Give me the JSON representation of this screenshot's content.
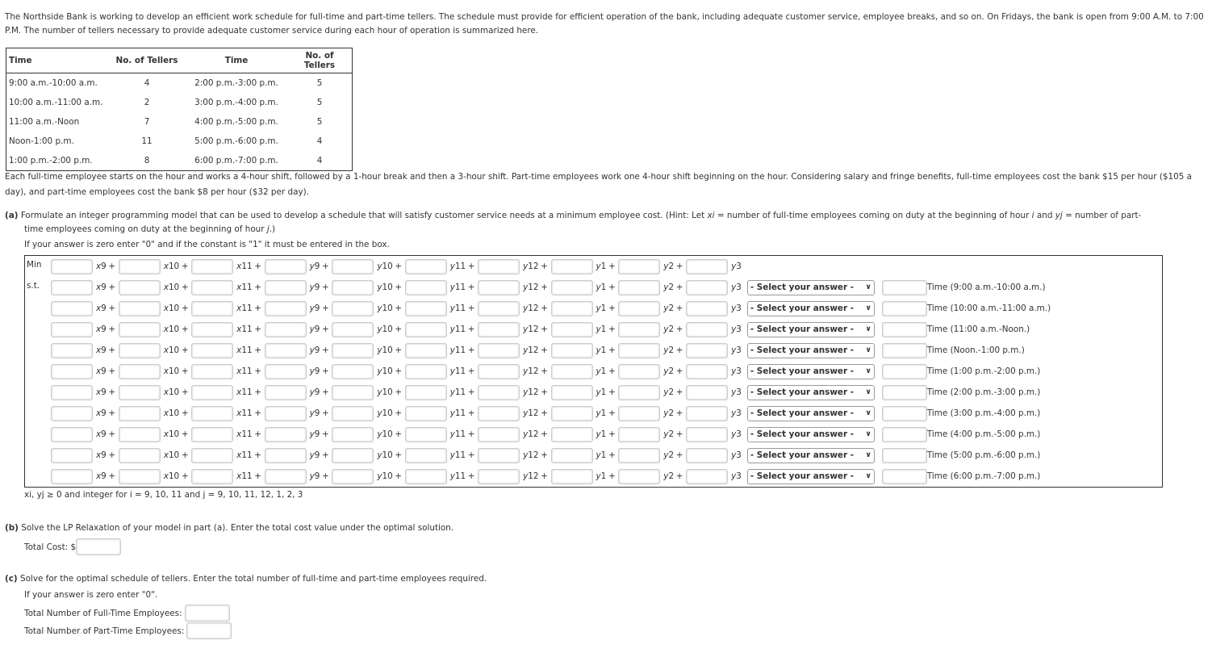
{
  "intro": "The Northside Bank is working to develop an efficient work schedule for full-time and part-time tellers. The schedule must provide for efficient operation of the bank, including adequate customer service, employee breaks, and so on. On Fridays, the bank is open from 9:00 A.M. to 7:00 P.M. The number of tellers necessary to provide adequate customer service during each hour of operation is summarized here.",
  "tellers_table": {
    "headers": [
      "Time",
      "No. of Tellers",
      "Time",
      "No. of Tellers"
    ],
    "rows": [
      [
        "9:00 a.m.-10:00 a.m.",
        "4",
        "2:00 p.m.-3:00 p.m.",
        "5"
      ],
      [
        "10:00 a.m.-11:00 a.m.",
        "2",
        "3:00 p.m.-4:00 p.m.",
        "5"
      ],
      [
        "11:00 a.m.-Noon",
        "7",
        "4:00 p.m.-5:00 p.m.",
        "5"
      ],
      [
        "Noon-1:00 p.m.",
        "11",
        "5:00 p.m.-6:00 p.m.",
        "4"
      ],
      [
        "1:00 p.m.-2:00 p.m.",
        "8",
        "6:00 p.m.-7:00 p.m.",
        "4"
      ]
    ]
  },
  "shift_text": "Each full-time employee starts on the hour and works a 4-hour shift, followed by a 1-hour break and then a 3-hour shift. Part-time employees work one 4-hour shift beginning on the hour. Considering salary and fringe benefits, full-time employees cost the bank $15 per hour ($105 a day), and part-time employees cost the bank $8 per hour ($32 per day).",
  "part_a": {
    "label": "(a)",
    "text1": " Formulate an integer programming model that can be used to develop a schedule that will satisfy customer service needs at a minimum employee cost. (Hint: Let ",
    "xi": "xi",
    "text2": " = number of full-time employees coming on duty at the beginning of hour ",
    "i": "i",
    "text3": " and ",
    "yj": "yj",
    "text4": " = number of part-",
    "text5": "time employees coming on duty at the beginning of hour ",
    "j": "j",
    "text6": ".)",
    "hint": "If your answer is zero enter \"0\" and if the constant is \"1\" it must be entered in the box.",
    "min_label": "Min",
    "st_label": "s.t.",
    "variables": [
      "x9",
      "x10",
      "x11",
      "y9",
      "y10",
      "y11",
      "y12",
      "y1",
      "y2",
      "y3"
    ],
    "select_placeholder": "- Select your answer -",
    "constraint_labels": [
      "Time (9:00 a.m.-10:00 a.m.)",
      "Time (10:00 a.m.-11:00 a.m.)",
      "Time (11:00 a.m.-Noon.)",
      "Time (Noon.-1:00 p.m.)",
      "Time (1:00 p.m.-2:00 p.m.)",
      "Time (2:00 p.m.-3:00 p.m.)",
      "Time (3:00 p.m.-4:00 p.m.)",
      "Time (4:00 p.m.-5:00 p.m.)",
      "Time (5:00 p.m.-6:00 p.m.)",
      "Time (6:00 p.m.-7:00 p.m.)"
    ],
    "integer_text": "xi, yj ≥ 0 and integer for i = 9, 10, 11 and j = 9, 10, 11, 12, 1, 2, 3"
  },
  "part_b": {
    "label": "(b)",
    "text": " Solve the LP Relaxation of your model in part (a). Enter the total cost value under the optimal solution.",
    "total_cost_label": "Total Cost: $"
  },
  "part_c": {
    "label": "(c)",
    "text": " Solve for the optimal schedule of tellers. Enter the total number of full-time and part-time employees required.",
    "zero_hint": "If your answer is zero enter \"0\".",
    "full_time_label": "Total Number of Full-Time Employees:",
    "part_time_label": "Total Number of Part-Time Employees:"
  }
}
